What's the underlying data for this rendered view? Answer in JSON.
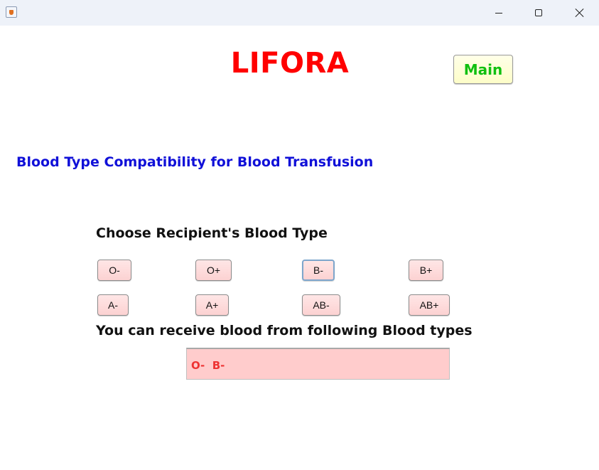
{
  "window": {
    "icon": "java-cup-icon",
    "controls": [
      "minimize-icon",
      "maximize-icon",
      "close-icon"
    ]
  },
  "app": {
    "title": "LIFORA",
    "main_button_label": "Main",
    "subtitle": "Blood Type Compatibility for Blood Transfusion"
  },
  "chooser": {
    "label": "Choose Recipient's Blood Type",
    "buttons": [
      "O-",
      "O+",
      "B-",
      "B+",
      "A-",
      "A+",
      "AB-",
      "AB+"
    ],
    "selected": "B-"
  },
  "result": {
    "label": "You can receive blood from following Blood types",
    "value": "O-  B-"
  },
  "colors": {
    "title": "#ff0000",
    "subtitle": "#1010d8",
    "main_button_text": "#10c010",
    "main_button_bg": "#fdfdc8",
    "blood_button_bg": "#fcd2d2",
    "result_bg": "#ffcccc",
    "result_text": "#ee3333"
  }
}
